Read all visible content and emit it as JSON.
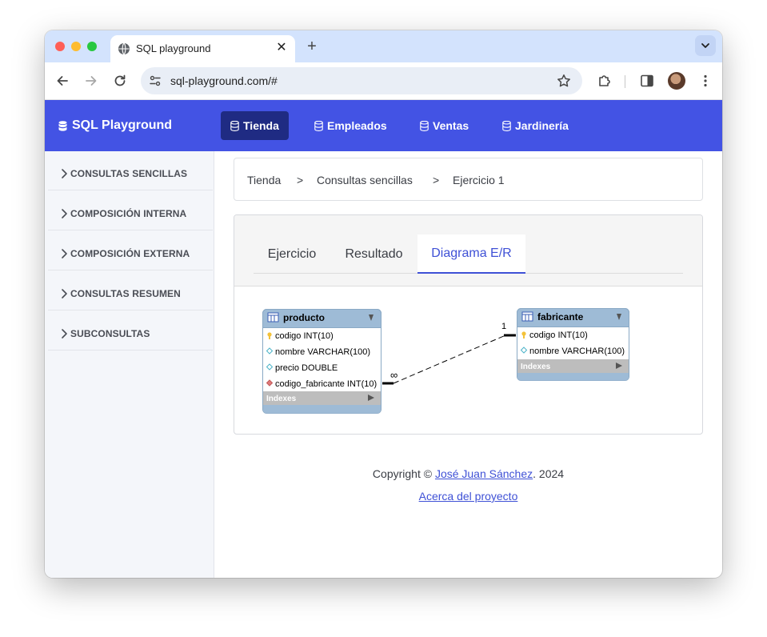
{
  "browser": {
    "tab_title": "SQL playground",
    "close_glyph": "✕",
    "new_tab_glyph": "+",
    "url": "sql-playground.com/#",
    "icons": [
      "globe-icon",
      "back-icon",
      "forward-icon",
      "reload-icon",
      "site-settings-icon",
      "bookmark-star-icon",
      "extensions-icon",
      "side-panel-icon",
      "profile-avatar",
      "kebab-menu-icon",
      "tab-search-icon"
    ]
  },
  "nav": {
    "brand": "SQL Playground",
    "items": [
      {
        "label": "Tienda",
        "active": true
      },
      {
        "label": "Empleados",
        "active": false
      },
      {
        "label": "Ventas",
        "active": false
      },
      {
        "label": "Jardinería",
        "active": false
      }
    ],
    "accent": "#4353e4",
    "active_bg": "#1f2b83"
  },
  "sidebar": {
    "items": [
      {
        "label": "CONSULTAS SENCILLAS"
      },
      {
        "label": "COMPOSICIÓN INTERNA"
      },
      {
        "label": "COMPOSICIÓN EXTERNA"
      },
      {
        "label": "CONSULTAS RESUMEN"
      },
      {
        "label": "SUBCONSULTAS"
      }
    ]
  },
  "breadcrumb": {
    "items": [
      "Tienda",
      "Consultas sencillas",
      "Ejercicio 1"
    ],
    "separator": ">"
  },
  "card": {
    "tabs": [
      {
        "label": "Ejercicio",
        "active": false
      },
      {
        "label": "Resultado",
        "active": false
      },
      {
        "label": "Diagrama E/R",
        "active": true
      }
    ]
  },
  "er_diagram": {
    "tables": [
      {
        "name": "producto",
        "columns": [
          {
            "text": "codigo INT(10)",
            "kind": "primary-key"
          },
          {
            "text": "nombre VARCHAR(100)",
            "kind": "column"
          },
          {
            "text": "precio DOUBLE",
            "kind": "column"
          },
          {
            "text": "codigo_fabricante INT(10)",
            "kind": "foreign-key"
          }
        ],
        "indexes_label": "Indexes"
      },
      {
        "name": "fabricante",
        "columns": [
          {
            "text": "codigo INT(10)",
            "kind": "primary-key"
          },
          {
            "text": "nombre VARCHAR(100)",
            "kind": "column"
          }
        ],
        "indexes_label": "Indexes"
      }
    ],
    "relationship": {
      "from_cardinality": "∞",
      "to_cardinality": "1"
    }
  },
  "footer": {
    "prefix": "Copyright © ",
    "author": "José Juan Sánchez",
    "suffix": ". 2024",
    "about": "Acerca del proyecto"
  }
}
